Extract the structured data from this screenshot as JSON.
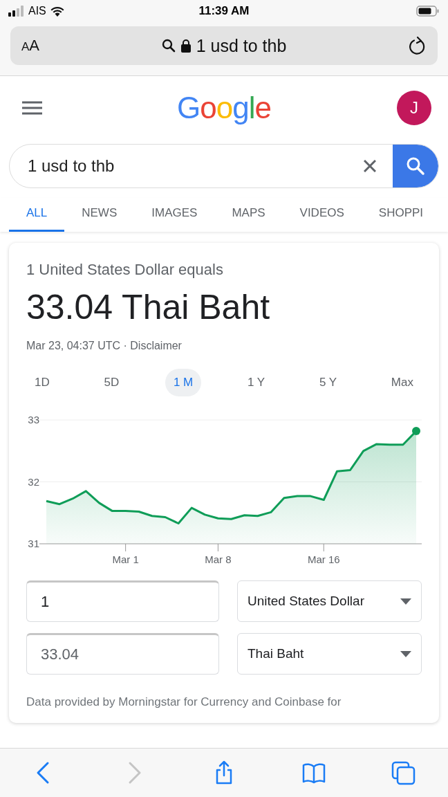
{
  "status_bar": {
    "carrier": "AIS",
    "time": "11:39 AM"
  },
  "address_bar": {
    "text_size": "AA",
    "url": "1 usd to thb"
  },
  "header": {
    "logo": "Google",
    "avatar": "J"
  },
  "search": {
    "value": "1 usd to thb"
  },
  "tabs": [
    {
      "label": "ALL",
      "selected": true
    },
    {
      "label": "NEWS",
      "selected": false
    },
    {
      "label": "IMAGES",
      "selected": false
    },
    {
      "label": "MAPS",
      "selected": false
    },
    {
      "label": "VIDEOS",
      "selected": false
    },
    {
      "label": "SHOPPI",
      "selected": false
    }
  ],
  "converter": {
    "heading": "1 United States Dollar equals",
    "result": "33.04 Thai Baht",
    "timestamp": "Mar 23, 04:37 UTC · Disclaimer",
    "ranges": [
      {
        "label": "1D",
        "selected": false
      },
      {
        "label": "5D",
        "selected": false
      },
      {
        "label": "1 M",
        "selected": true
      },
      {
        "label": "1 Y",
        "selected": false
      },
      {
        "label": "5 Y",
        "selected": false
      },
      {
        "label": "Max",
        "selected": false
      }
    ],
    "chart_data": {
      "type": "area",
      "categories": [
        null,
        null,
        null,
        null,
        null,
        null,
        "Mar 1",
        null,
        null,
        null,
        null,
        null,
        null,
        "Mar 8",
        null,
        null,
        null,
        null,
        null,
        null,
        null,
        "Mar 16",
        null,
        null,
        null,
        null,
        null,
        null,
        null
      ],
      "series": [
        {
          "color": "#0f9d58",
          "values": [
            31.69,
            31.64,
            31.73,
            31.85,
            31.66,
            31.53,
            31.53,
            31.52,
            31.45,
            31.43,
            31.33,
            31.58,
            31.47,
            31.41,
            31.4,
            31.46,
            31.45,
            31.51,
            31.74,
            31.77,
            31.77,
            31.71,
            32.17,
            32.19,
            32.5,
            32.61,
            32.6,
            32.6,
            32.82
          ]
        }
      ],
      "ylim": [
        31,
        33
      ],
      "yticks": [
        31,
        32,
        33
      ]
    },
    "rows": [
      {
        "amount": "1",
        "currency": "United States Dollar"
      },
      {
        "amount": "33.04",
        "currency": "Thai Baht"
      }
    ],
    "source_note": "Data provided by Morningstar for Currency and Coinbase for"
  },
  "toolbar": [
    {
      "kind": "back",
      "disabled": false
    },
    {
      "kind": "forward",
      "disabled": true
    },
    {
      "kind": "share",
      "disabled": false
    },
    {
      "kind": "bookmarks",
      "disabled": false
    },
    {
      "kind": "tabs",
      "disabled": false
    }
  ]
}
